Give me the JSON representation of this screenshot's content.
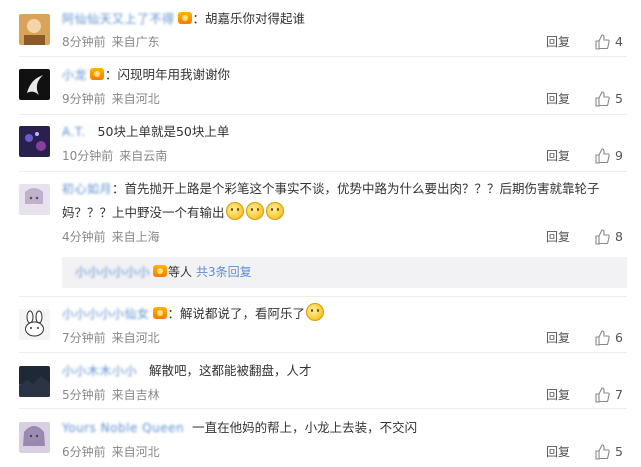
{
  "labels": {
    "reply": "回复",
    "sub_prefix": "等人",
    "sub_more": "共3条回复"
  },
  "comments": [
    {
      "user": "阿仙仙天又上了不得",
      "vip": true,
      "text": "：胡嘉乐你对得起谁",
      "time": "8分钟前",
      "location": "来自广东",
      "likes": "4",
      "avatar_color": "#d9a45a"
    },
    {
      "user": "小龙",
      "vip": true,
      "text": "：闪现明年用我谢谢你",
      "time": "9分钟前",
      "location": "来自河北",
      "likes": "5",
      "avatar_color": "#1a1a1a"
    },
    {
      "user": "A.T.",
      "vip": false,
      "text": "50块上单就是50块上单",
      "time": "10分钟前",
      "location": "来自云南",
      "likes": "9",
      "avatar_color": "#3b2f66"
    },
    {
      "user": "初心如月",
      "vip": false,
      "text": "：首先抛开上路是个彩笔这个事实不谈，优势中路为什么要出肉？？？后期伤害就靠轮子妈？？？上中野没一个有输出",
      "time": "4分钟前",
      "location": "来自上海",
      "likes": "8",
      "avatar_color": "#b9a9c9"
    },
    {
      "user": "小小小小小仙女",
      "vip": true,
      "text": "：解说都说了，看阿乐了",
      "time": "7分钟前",
      "location": "来自河北",
      "likes": "6",
      "avatar_color": "#f0f0f0"
    },
    {
      "user": "小小木木小小",
      "vip": false,
      "text": "解散吧，这都能被翻盘，人才",
      "time": "5分钟前",
      "location": "来自吉林",
      "likes": "7",
      "avatar_color": "#2f3a4a"
    },
    {
      "user": "Yours Noble Queen",
      "vip": false,
      "text": "一直在他妈的帮上，小龙上去装，不交闪",
      "time": "6分钟前",
      "location": "来自河北",
      "likes": "5",
      "avatar_color": "#9a8fb0"
    }
  ],
  "sub_reply": {
    "user": "小小小小小小"
  }
}
